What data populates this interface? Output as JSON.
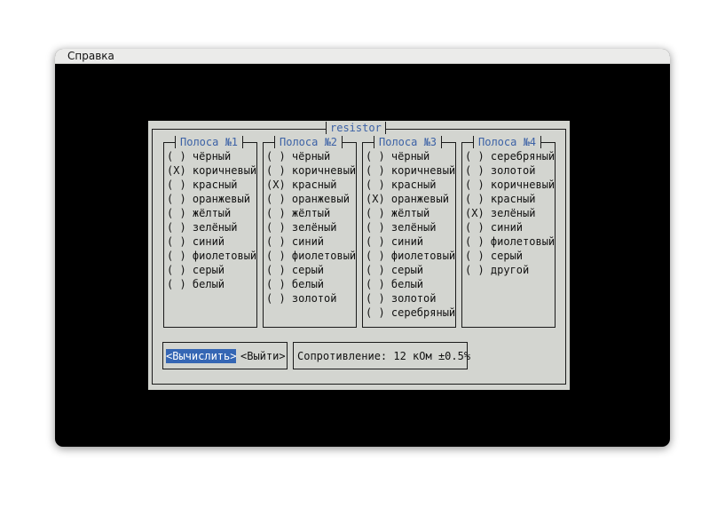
{
  "window": {
    "title": "Справка"
  },
  "dialog": {
    "title": "resistor"
  },
  "bands": [
    {
      "title": "Полоса №1",
      "options": [
        "( ) чёрный",
        "(X) коричневый",
        "( ) красный",
        "( ) оранжевый",
        "( ) жёлтый",
        "( ) зелёный",
        "( ) синий",
        "( ) фиолетовый",
        "( ) серый",
        "( ) белый"
      ]
    },
    {
      "title": "Полоса №2",
      "options": [
        "( ) чёрный",
        "( ) коричневый",
        "(X) красный",
        "( ) оранжевый",
        "( ) жёлтый",
        "( ) зелёный",
        "( ) синий",
        "( ) фиолетовый",
        "( ) серый",
        "( ) белый",
        "( ) золотой"
      ]
    },
    {
      "title": "Полоса №3",
      "options": [
        "( ) чёрный",
        "( ) коричневый",
        "( ) красный",
        "(X) оранжевый",
        "( ) жёлтый",
        "( ) зелёный",
        "( ) синий",
        "( ) фиолетовый",
        "( ) серый",
        "( ) белый",
        "( ) золотой",
        "( ) серебряный"
      ]
    },
    {
      "title": "Полоса №4",
      "options": [
        "( ) серебряный",
        "( ) золотой",
        "( ) коричневый",
        "( ) красный",
        "(X) зелёный",
        "( ) синий",
        "( ) фиолетовый",
        "( ) серый",
        "( ) другой"
      ]
    }
  ],
  "buttons": {
    "calculate": "<Вычислить>",
    "exit": "<Выйти>"
  },
  "result": {
    "text": "Сопротивление: 12 кОм ±0.5%"
  },
  "colors": {
    "dialog_bg": "#d3d5d0",
    "title_text": "#3c62a6",
    "focus_bg": "#3566b4",
    "terminal_bg": "#000000"
  }
}
